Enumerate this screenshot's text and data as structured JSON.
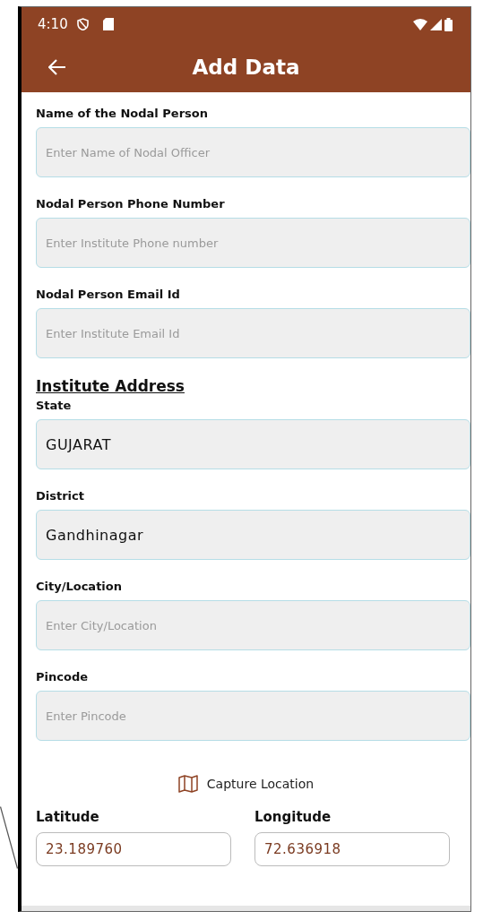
{
  "status_bar": {
    "time": "4:10"
  },
  "app_bar": {
    "title": "Add Data"
  },
  "fields": [
    {
      "label": "Name of the Nodal Person",
      "placeholder": "Enter Name of Nodal Officer"
    },
    {
      "label": "Nodal Person Phone Number",
      "placeholder": "Enter Institute Phone number"
    },
    {
      "label": "Nodal Person Email Id",
      "placeholder": "Enter Institute Email Id"
    }
  ],
  "section_title": "Institute Address",
  "address_fields": [
    {
      "label": "State",
      "value": "GUJARAT"
    },
    {
      "label": "District",
      "value": "Gandhinagar"
    },
    {
      "label": "City/Location",
      "placeholder": "Enter City/Location"
    },
    {
      "label": "Pincode",
      "placeholder": "Enter Pincode"
    }
  ],
  "capture_button": {
    "label": "Capture Location"
  },
  "coordinates": [
    {
      "label": "Latitude",
      "value": "23.189760"
    },
    {
      "label": "Longitude",
      "value": "72.636918"
    }
  ]
}
